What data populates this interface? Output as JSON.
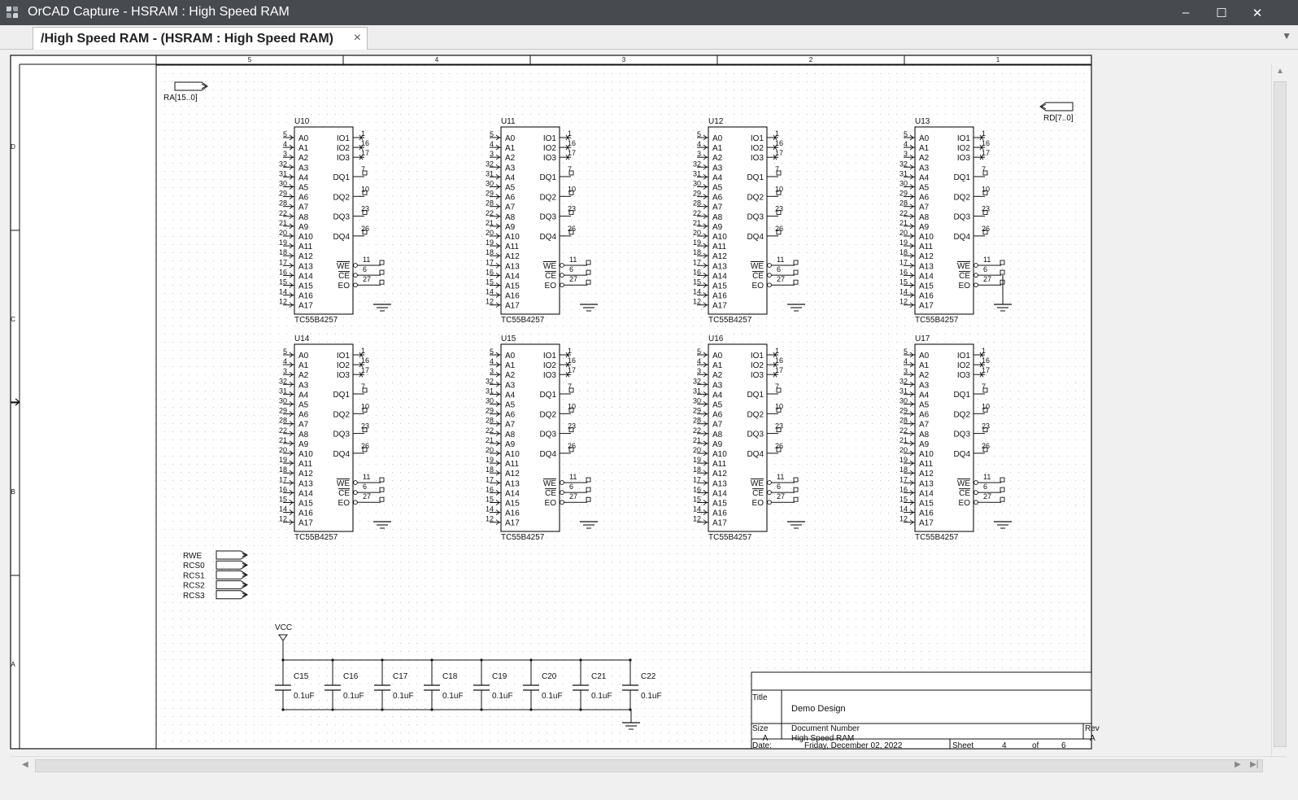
{
  "window": {
    "title": "OrCAD Capture - HSRAM : High Speed RAM",
    "minimize": "–",
    "maximize": "☐",
    "close": "✕"
  },
  "tab": {
    "label": "/High Speed  RAM - (HSRAM : High Speed RAM)",
    "close": "×",
    "overflow": "▼"
  },
  "scroll": {
    "up": "▲",
    "down": "▼",
    "left": "◀",
    "right": "▶",
    "right2": "▶|"
  },
  "ruler": {
    "columns": [
      "5",
      "4",
      "3",
      "2",
      "1"
    ],
    "rows": [
      "D",
      "C",
      "B",
      "A"
    ]
  },
  "ports": {
    "ra": "RA[15..0]",
    "rd": "RD[7..0]",
    "control": [
      "RWE",
      "RCS0",
      "RCS1",
      "RCS2",
      "RCS3"
    ]
  },
  "ram_part": {
    "part_number": "TC55B4257",
    "left_pins": [
      "A0",
      "A1",
      "A2",
      "A3",
      "A4",
      "A5",
      "A6",
      "A7",
      "A8",
      "A9",
      "A10",
      "A11",
      "A12",
      "A13",
      "A14",
      "A15",
      "A16",
      "A17"
    ],
    "left_pin_numbers": [
      "5",
      "4",
      "3",
      "32",
      "31",
      "30",
      "29",
      "28",
      "22",
      "21",
      "20",
      "19",
      "18",
      "17",
      "16",
      "15",
      "14",
      "12"
    ],
    "io_pins": [
      "IO1",
      "IO2",
      "IO3"
    ],
    "io_pin_numbers": [
      "1",
      "16",
      "17"
    ],
    "dq_pins": [
      "DQ1",
      "DQ2",
      "DQ3",
      "DQ4"
    ],
    "dq_pin_numbers": [
      "7",
      "10",
      "23",
      "26"
    ],
    "ctrl_pins": [
      "WE",
      "CE",
      "EO"
    ],
    "ctrl_pin_numbers": [
      "11",
      "6",
      "27"
    ]
  },
  "ram_chips": [
    "U10",
    "U11",
    "U12",
    "U13",
    "U14",
    "U15",
    "U16",
    "U17"
  ],
  "power": {
    "vcc": "VCC"
  },
  "capacitors": [
    {
      "ref": "C15",
      "value": "0.1uF"
    },
    {
      "ref": "C16",
      "value": "0.1uF"
    },
    {
      "ref": "C17",
      "value": "0.1uF"
    },
    {
      "ref": "C18",
      "value": "0.1uF"
    },
    {
      "ref": "C19",
      "value": "0.1uF"
    },
    {
      "ref": "C20",
      "value": "0.1uF"
    },
    {
      "ref": "C21",
      "value": "0.1uF"
    },
    {
      "ref": "C22",
      "value": "0.1uF"
    }
  ],
  "title_block": {
    "title_label": "Title",
    "title": "Demo Design",
    "size_label": "Size",
    "size": "A",
    "doc_label": "Document Number",
    "doc": "High Speed RAM",
    "rev_label": "Rev",
    "rev": "A",
    "date_label": "Date:",
    "date": "Friday, December 02, 2022",
    "sheet_label": "Sheet",
    "sheet": "4",
    "of_label": "of",
    "of": "6"
  }
}
